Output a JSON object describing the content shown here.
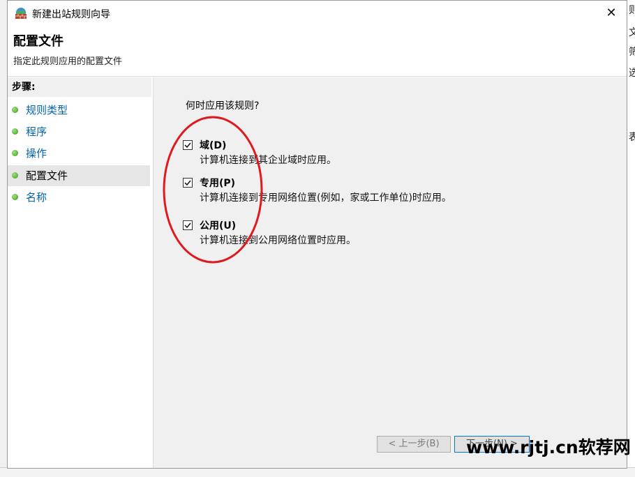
{
  "window": {
    "title": "新建出站规则向导",
    "close_label": "✕"
  },
  "header": {
    "title": "配置文件",
    "subtitle": "指定此规则应用的配置文件"
  },
  "steps": {
    "label": "步骤:",
    "items": [
      {
        "label": "规则类型",
        "active": false
      },
      {
        "label": "程序",
        "active": false
      },
      {
        "label": "操作",
        "active": false
      },
      {
        "label": "配置文件",
        "active": true
      },
      {
        "label": "名称",
        "active": false
      }
    ]
  },
  "content": {
    "question": "何时应用该规则?",
    "options": [
      {
        "label": "域(D)",
        "desc": "计算机连接到其企业域时应用。",
        "checked": true
      },
      {
        "label": "专用(P)",
        "desc": "计算机连接到专用网络位置(例如，家或工作单位)时应用。",
        "checked": true
      },
      {
        "label": "公用(U)",
        "desc": "计算机连接到公用网络位置时应用。",
        "checked": true
      }
    ]
  },
  "buttons": {
    "back": "< 上一步(B)",
    "next": "下一步(N) >"
  },
  "background_fragments": [
    "则",
    "文",
    "筛",
    "选",
    "表"
  ],
  "watermark": "www.rjtj.cn软荐网",
  "colors": {
    "link": "#0063b1",
    "annotation": "#e0191e",
    "dot": "#3b9c1d"
  },
  "icons": {
    "app": "firewall-globe-icon",
    "step": "green-dot-icon",
    "checkbox": "checkmark-icon"
  }
}
